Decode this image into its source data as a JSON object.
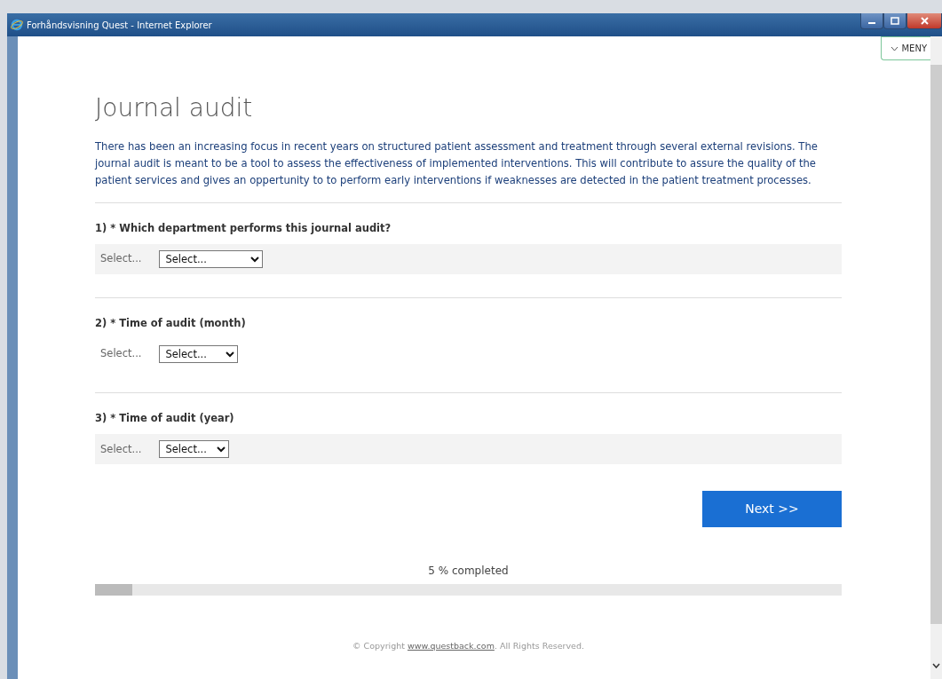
{
  "window": {
    "title": "Forhåndsvisning Quest - Internet Explorer"
  },
  "menu_button": {
    "label": "MENY"
  },
  "survey": {
    "title": "Journal audit",
    "intro": "There has been an increasing focus in recent years on structured patient assessment and treatment through several external revisions. The journal audit is meant to be a tool to assess the effectiveness of implemented interventions. This will contribute to assure the quality of the patient services and gives an oppertunity to to perform early interventions if weaknesses are detected in the patient treatment processes.",
    "questions": [
      {
        "number": "1)",
        "text": "* Which department performs this journal audit?",
        "label": "Select...",
        "value": "Select...",
        "shaded": true
      },
      {
        "number": "2)",
        "text": "* Time of audit (month)",
        "label": "Select...",
        "value": "Select...",
        "shaded": false
      },
      {
        "number": "3)",
        "text": "* Time of audit (year)",
        "label": "Select...",
        "value": "Select...",
        "shaded": true
      }
    ],
    "next_button": "Next >>",
    "progress": {
      "text": "5 % completed",
      "level": 0.05
    },
    "footer": {
      "prefix": "© Copyright ",
      "link": "www.questback.com",
      "suffix": ". All Rights Reserved."
    }
  }
}
